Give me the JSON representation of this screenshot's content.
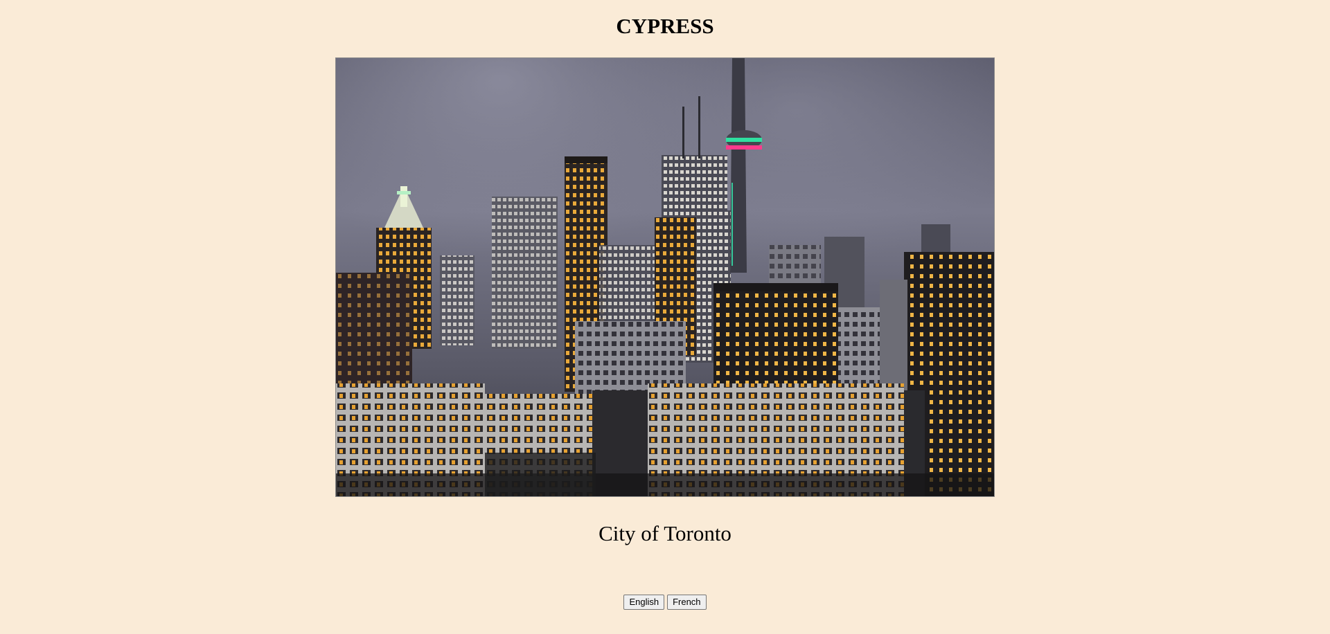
{
  "header": {
    "title": "CYPRESS"
  },
  "main": {
    "image_alt": "City of Toronto",
    "caption": "City of Toronto"
  },
  "language_buttons": {
    "english_label": "English",
    "french_label": "French"
  },
  "colors": {
    "page_background": "#faebd7",
    "sky": "#6b6b7d",
    "window_light": "#f2b53a"
  }
}
